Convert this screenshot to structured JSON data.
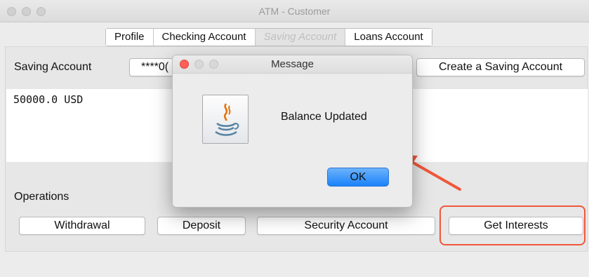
{
  "window": {
    "title": "ATM - Customer"
  },
  "tabs": [
    {
      "label": "Profile"
    },
    {
      "label": "Checking Account"
    },
    {
      "label": "Saving Account"
    },
    {
      "label": "Loans Account"
    }
  ],
  "saving": {
    "label": "Saving Account",
    "account_masked": "****0(",
    "create_button": "Create a Saving Account",
    "balance_text": "50000.0 USD"
  },
  "operations": {
    "label": "Operations",
    "buttons": [
      "Withdrawal",
      "Deposit",
      "Security Account",
      "Get Interests"
    ]
  },
  "dialog": {
    "title": "Message",
    "message": "Balance Updated",
    "ok_label": "OK",
    "icon": "java-icon"
  },
  "colors": {
    "highlight": "#f0573a",
    "ok_button": "#1a82fb",
    "close_light": "#ff5f57"
  }
}
